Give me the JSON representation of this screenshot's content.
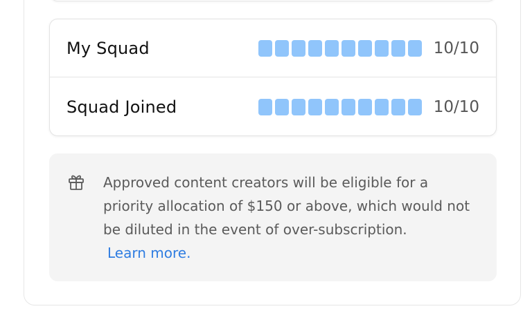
{
  "squad": {
    "rows": [
      {
        "label": "My Squad",
        "filled": 10,
        "total": 10,
        "count": "10/10"
      },
      {
        "label": "Squad Joined",
        "filled": 10,
        "total": 10,
        "count": "10/10"
      }
    ]
  },
  "info": {
    "icon": "gift-icon",
    "text": "Approved content creators will be eligible for a priority allocation of $150 or above, which would not be diluted in the event of over-subscription.",
    "link_label": "Learn more."
  },
  "colors": {
    "progress_fill": "#90c5fb",
    "progress_empty": "#e5e7eb",
    "link": "#2f7de1",
    "info_background": "#f4f4f4"
  }
}
